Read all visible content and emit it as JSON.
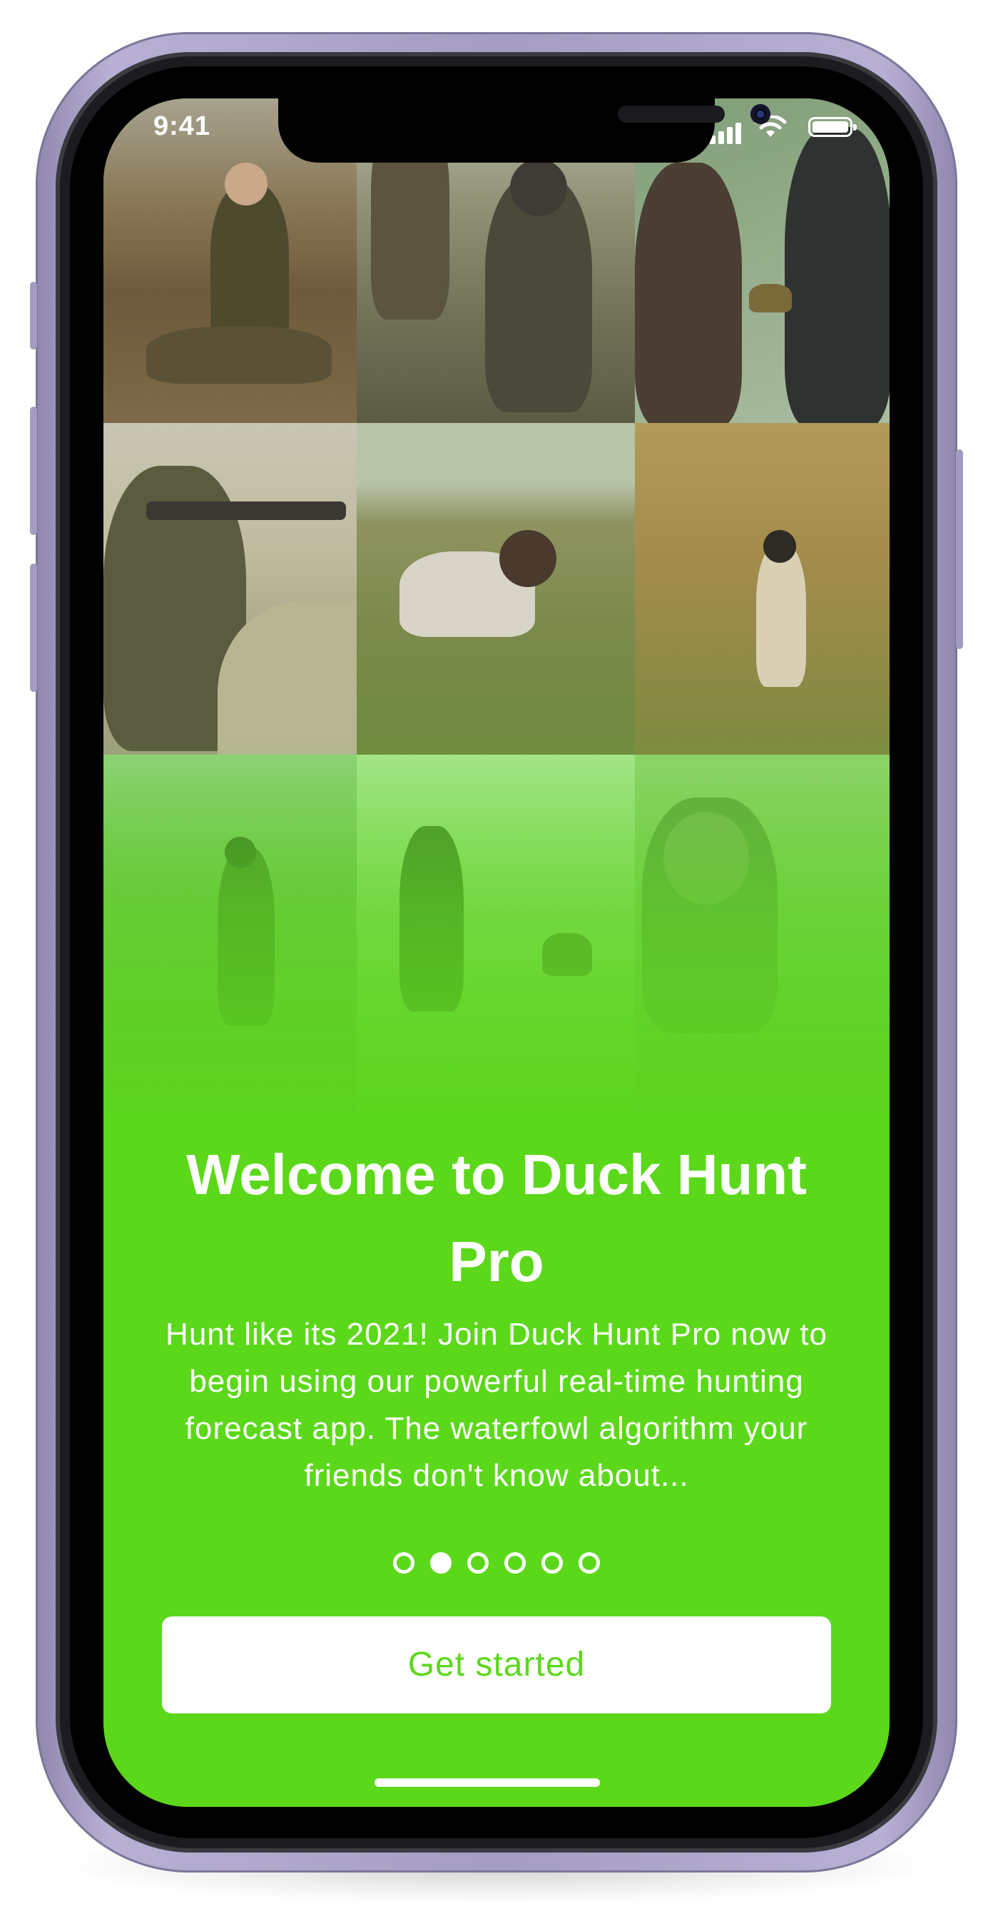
{
  "status_bar": {
    "time": "9:41"
  },
  "photo_grid": {
    "tiles": [
      {
        "name": "hunter-with-binoculars-photo"
      },
      {
        "name": "hunters-in-reeds-photo"
      },
      {
        "name": "couple-with-decoy-photo"
      },
      {
        "name": "rifle-scope-hunter-photo"
      },
      {
        "name": "hunting-dog-photo"
      },
      {
        "name": "hunter-in-tall-grass-photo"
      },
      {
        "name": "bare-trees-hunter-photo"
      },
      {
        "name": "hunter-with-dog-field-photo"
      },
      {
        "name": "camo-hunter-portrait-photo"
      }
    ]
  },
  "onboarding": {
    "title": "Welcome to Duck Hunt Pro",
    "body": "Hunt like its 2021! Join Duck Hunt Pro now to begin using our powerful real-time hunting forecast app. The waterfowl algorithm your friends don't know about...",
    "page_count": 6,
    "active_page": 2,
    "cta_label": "Get started"
  },
  "colors": {
    "brand_green": "#5bd81a",
    "frame_lavender": "#b8b0d4"
  }
}
